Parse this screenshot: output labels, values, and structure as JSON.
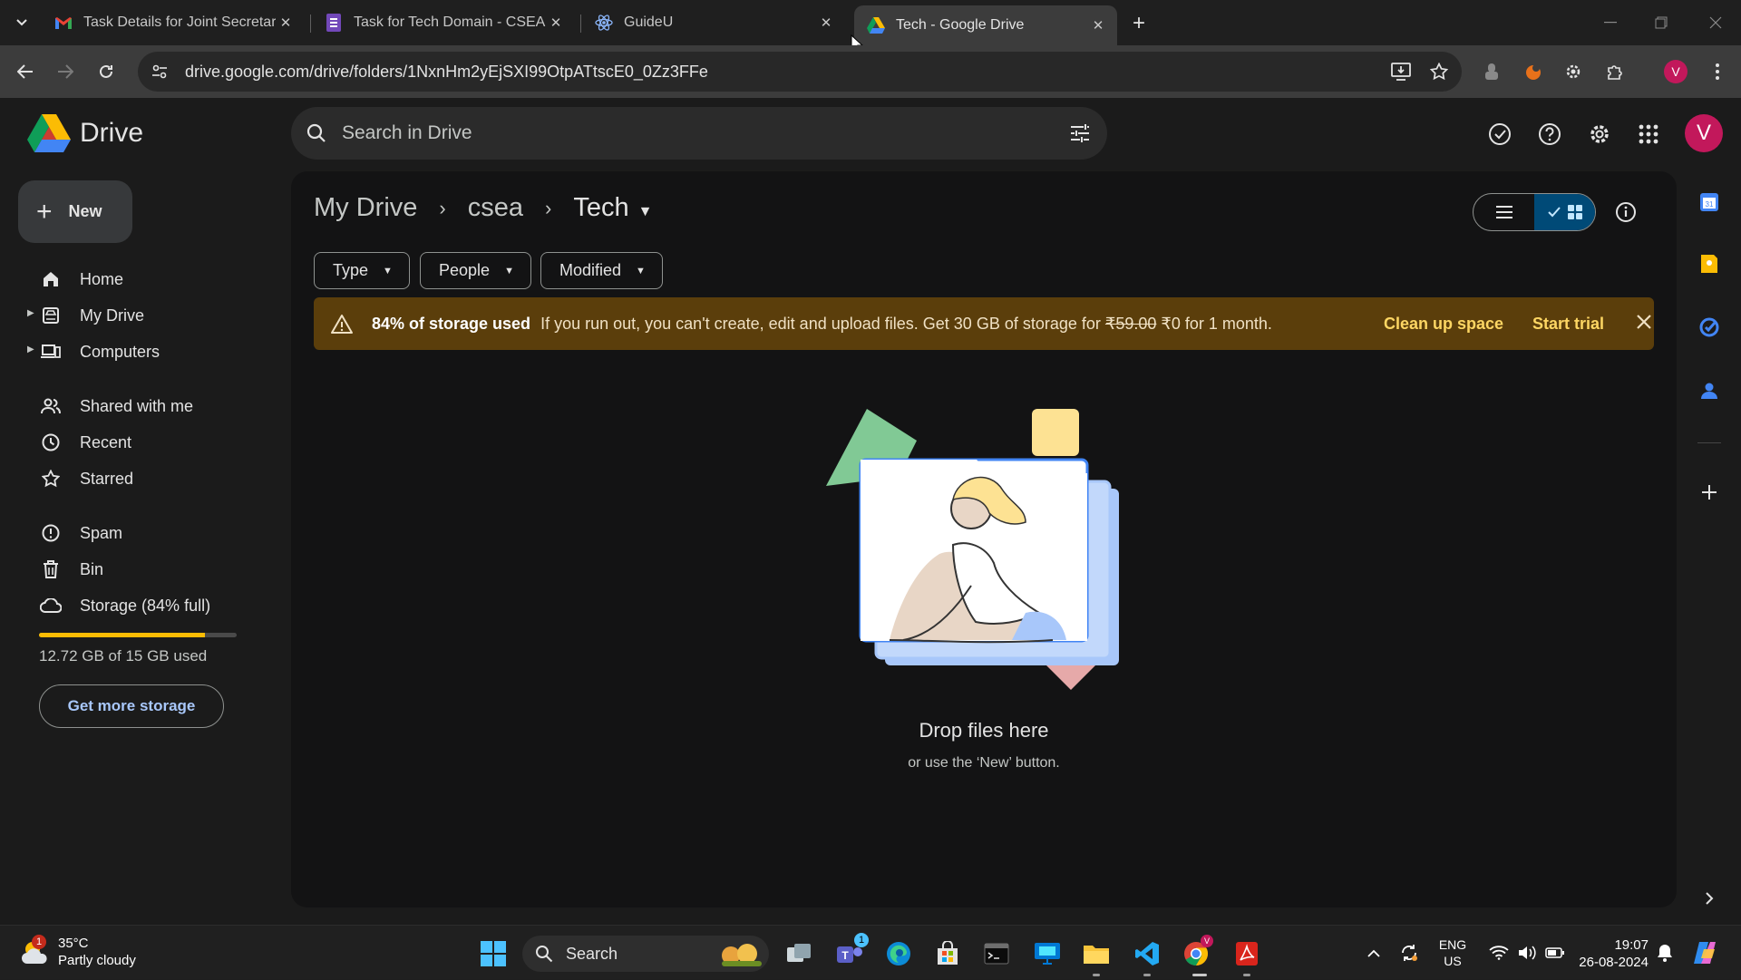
{
  "browser": {
    "tabs": [
      {
        "title": "Task Details for Joint Secretary I",
        "icon": "gmail-icon"
      },
      {
        "title": "Task for Tech Domain - CSEA",
        "icon": "forms-icon"
      },
      {
        "title": "GuideU",
        "icon": "react-icon"
      },
      {
        "title": "Tech - Google Drive",
        "icon": "drive-icon"
      }
    ],
    "url": "drive.google.com/drive/folders/1NxnHm2yEjSXI99OtpATtscE0_0Zz3FFe",
    "profile_initial": "V"
  },
  "drive": {
    "logo_text": "Drive",
    "search_placeholder": "Search in Drive",
    "avatar_initial": "V",
    "new_label": "New",
    "nav": {
      "home": "Home",
      "my_drive": "My Drive",
      "computers": "Computers",
      "shared": "Shared with me",
      "recent": "Recent",
      "starred": "Starred",
      "spam": "Spam",
      "bin": "Bin",
      "storage": "Storage (84% full)"
    },
    "storage_used_fraction": 0.84,
    "storage_text": "12.72 GB of 15 GB used",
    "get_more_storage": "Get more storage",
    "breadcrumb": {
      "root": "My Drive",
      "parent": "csea",
      "current": "Tech"
    },
    "filters": {
      "type": "Type",
      "people": "People",
      "modified": "Modified"
    },
    "banner": {
      "bold": "84% of storage used",
      "text_a": "If you run out, you can't create, edit and upload files. Get 30 GB of storage for",
      "old_price": "₹59.00",
      "text_b": "₹0 for 1 month.",
      "clean_up": "Clean up space",
      "start_trial": "Start trial"
    },
    "empty": {
      "title": "Drop files here",
      "subtitle": "or use the ‘New’ button."
    }
  },
  "taskbar": {
    "weather_temp": "35°C",
    "weather_desc": "Partly cloudy",
    "weather_badge": "1",
    "search_label": "Search",
    "teams_badge": "1",
    "lang_top": "ENG",
    "lang_bottom": "US",
    "time": "19:07",
    "date": "26-08-2024"
  },
  "colors": {
    "accent": "#a8c7fa",
    "storage_bar": "#fbbc04",
    "banner_bg": "#5b3e0b",
    "banner_action": "#fdd663"
  }
}
